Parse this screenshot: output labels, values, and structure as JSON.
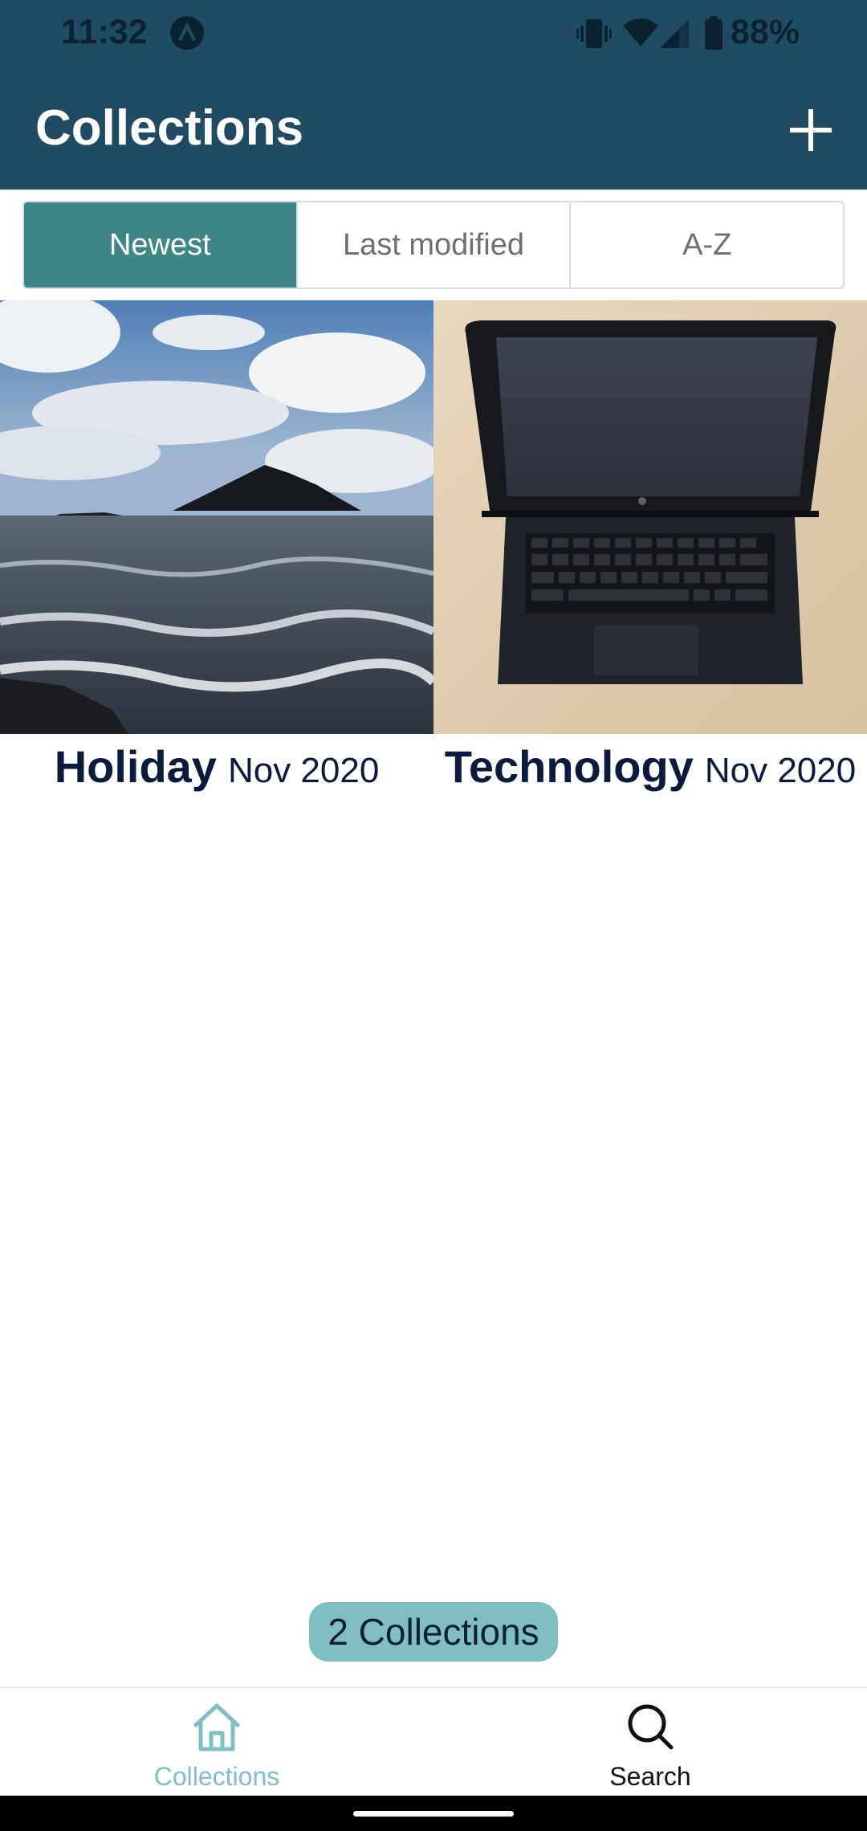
{
  "status_bar": {
    "time": "11:32",
    "notification_icon": "app-notification-icon",
    "battery": "88%",
    "icons": [
      "vibrate-icon",
      "wifi-icon",
      "signal-icon",
      "battery-icon"
    ]
  },
  "app_bar": {
    "title": "Collections",
    "add_icon": "plus-icon",
    "background": "#204b61"
  },
  "sort": {
    "options": [
      "Newest",
      "Last modified",
      "A-Z"
    ],
    "selected": "Newest",
    "accent": "#3d8885"
  },
  "collections": [
    {
      "name": "Holiday",
      "date": "Nov 2020",
      "thumbnail": "seascape-island-photo"
    },
    {
      "name": "Technology",
      "date": "Nov 2020",
      "thumbnail": "laptop-photo"
    }
  ],
  "count_label": "2 Collections",
  "bottom_nav": {
    "items": [
      {
        "label": "Collections",
        "icon": "home-icon",
        "active": true
      },
      {
        "label": "Search",
        "icon": "search-icon",
        "active": false
      }
    ],
    "active_color": "#7fbfc2"
  }
}
